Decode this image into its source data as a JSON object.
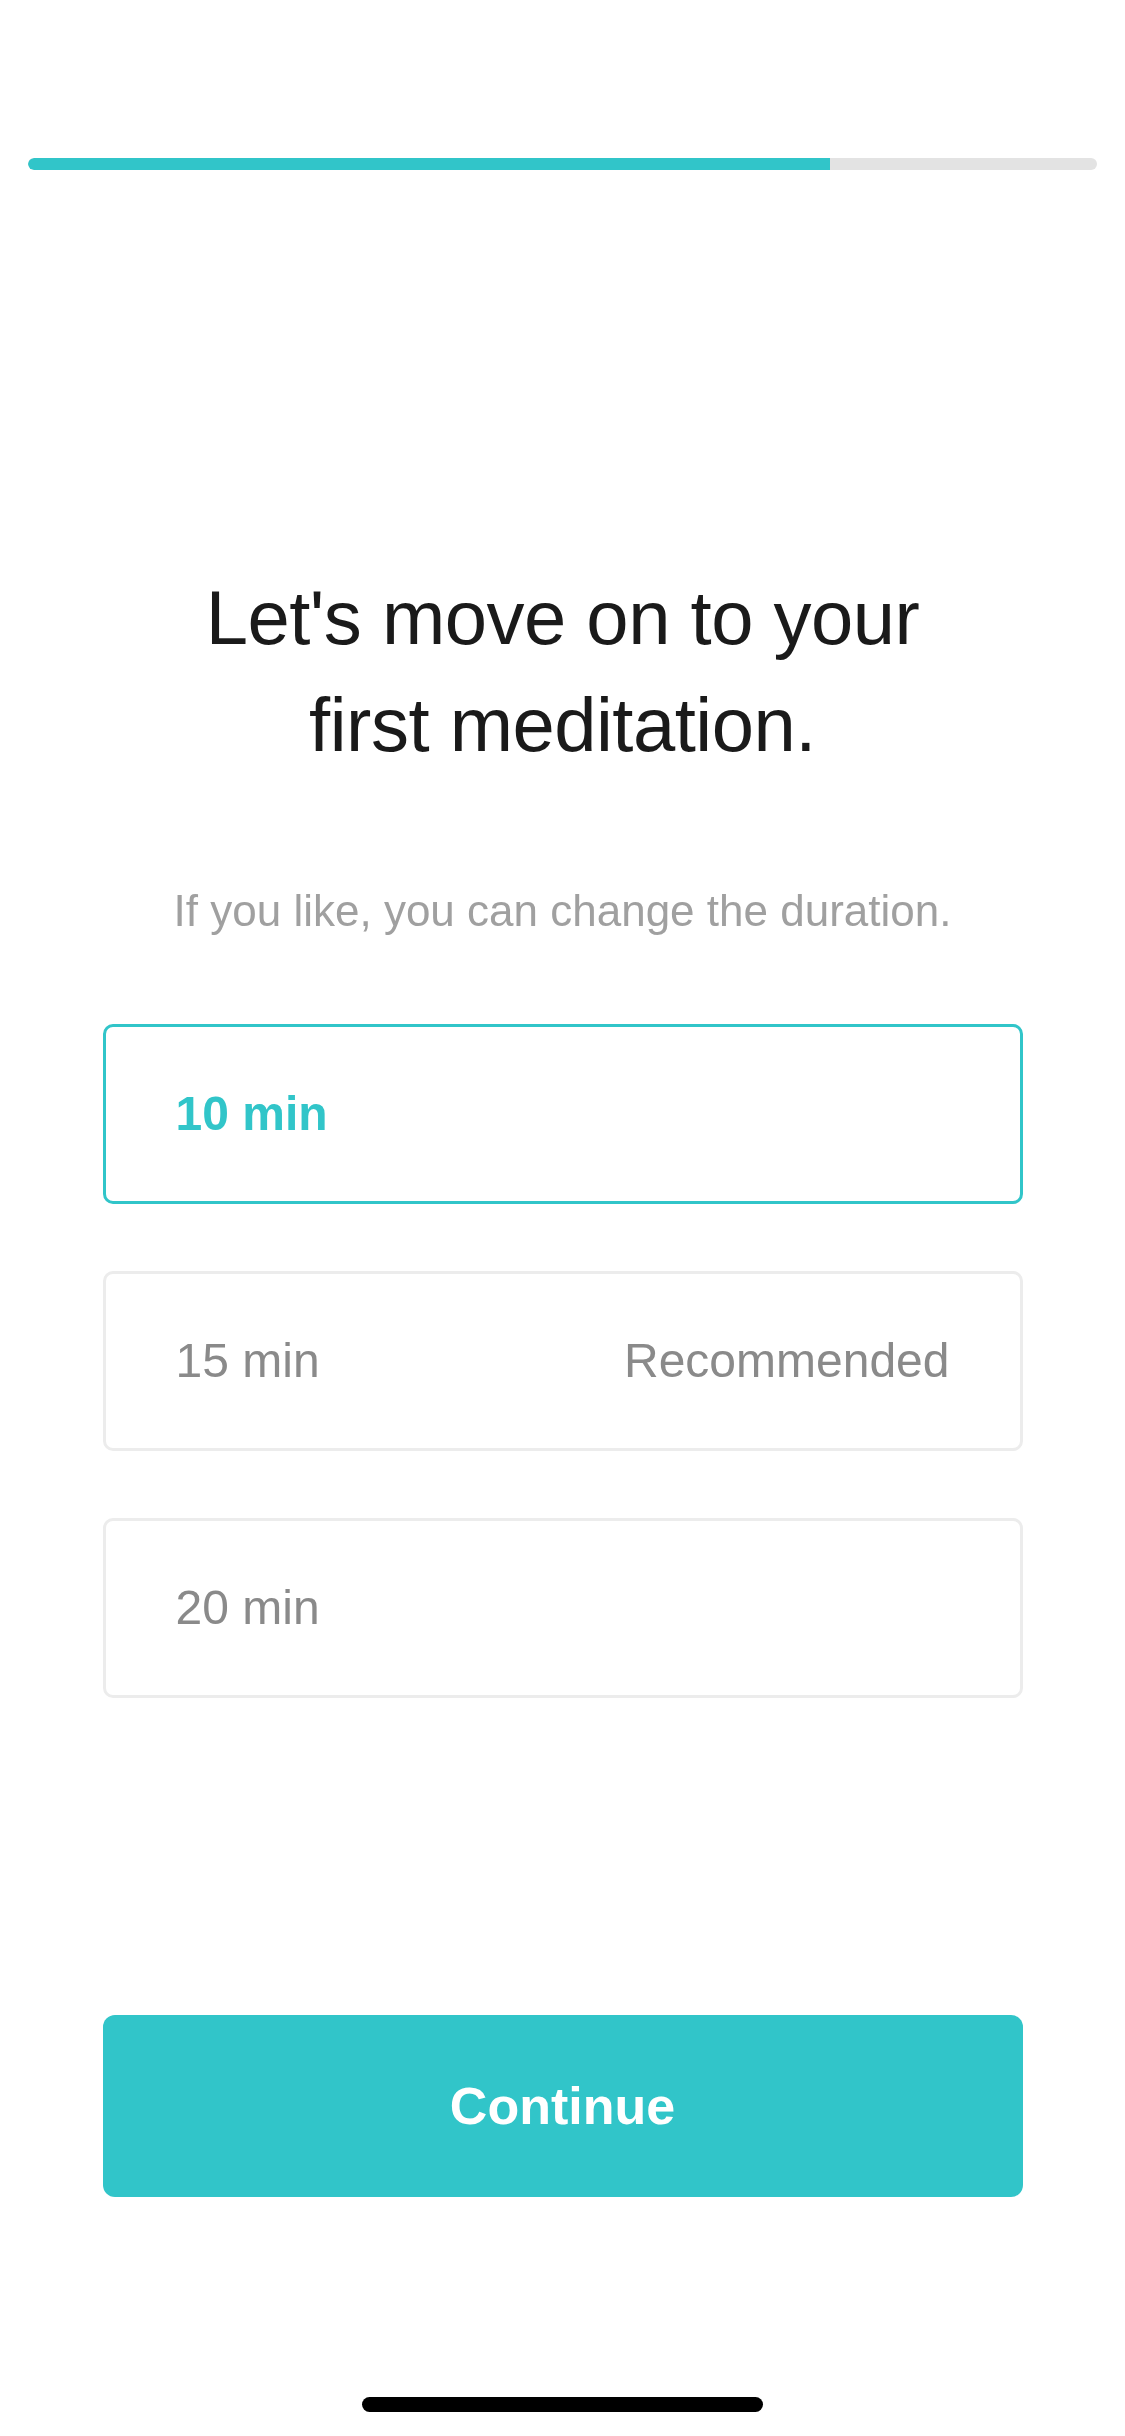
{
  "progress": {
    "level": 0.75
  },
  "title": "Let's move on to your first meditation.",
  "subtitle": "If you like, you can change the duration.",
  "options": [
    {
      "label": "10 min",
      "selected": true
    },
    {
      "label": "15 min",
      "note": "Recommended",
      "selected": false
    },
    {
      "label": "20 min",
      "selected": false
    }
  ],
  "continue_button": {
    "label": "Continue"
  }
}
